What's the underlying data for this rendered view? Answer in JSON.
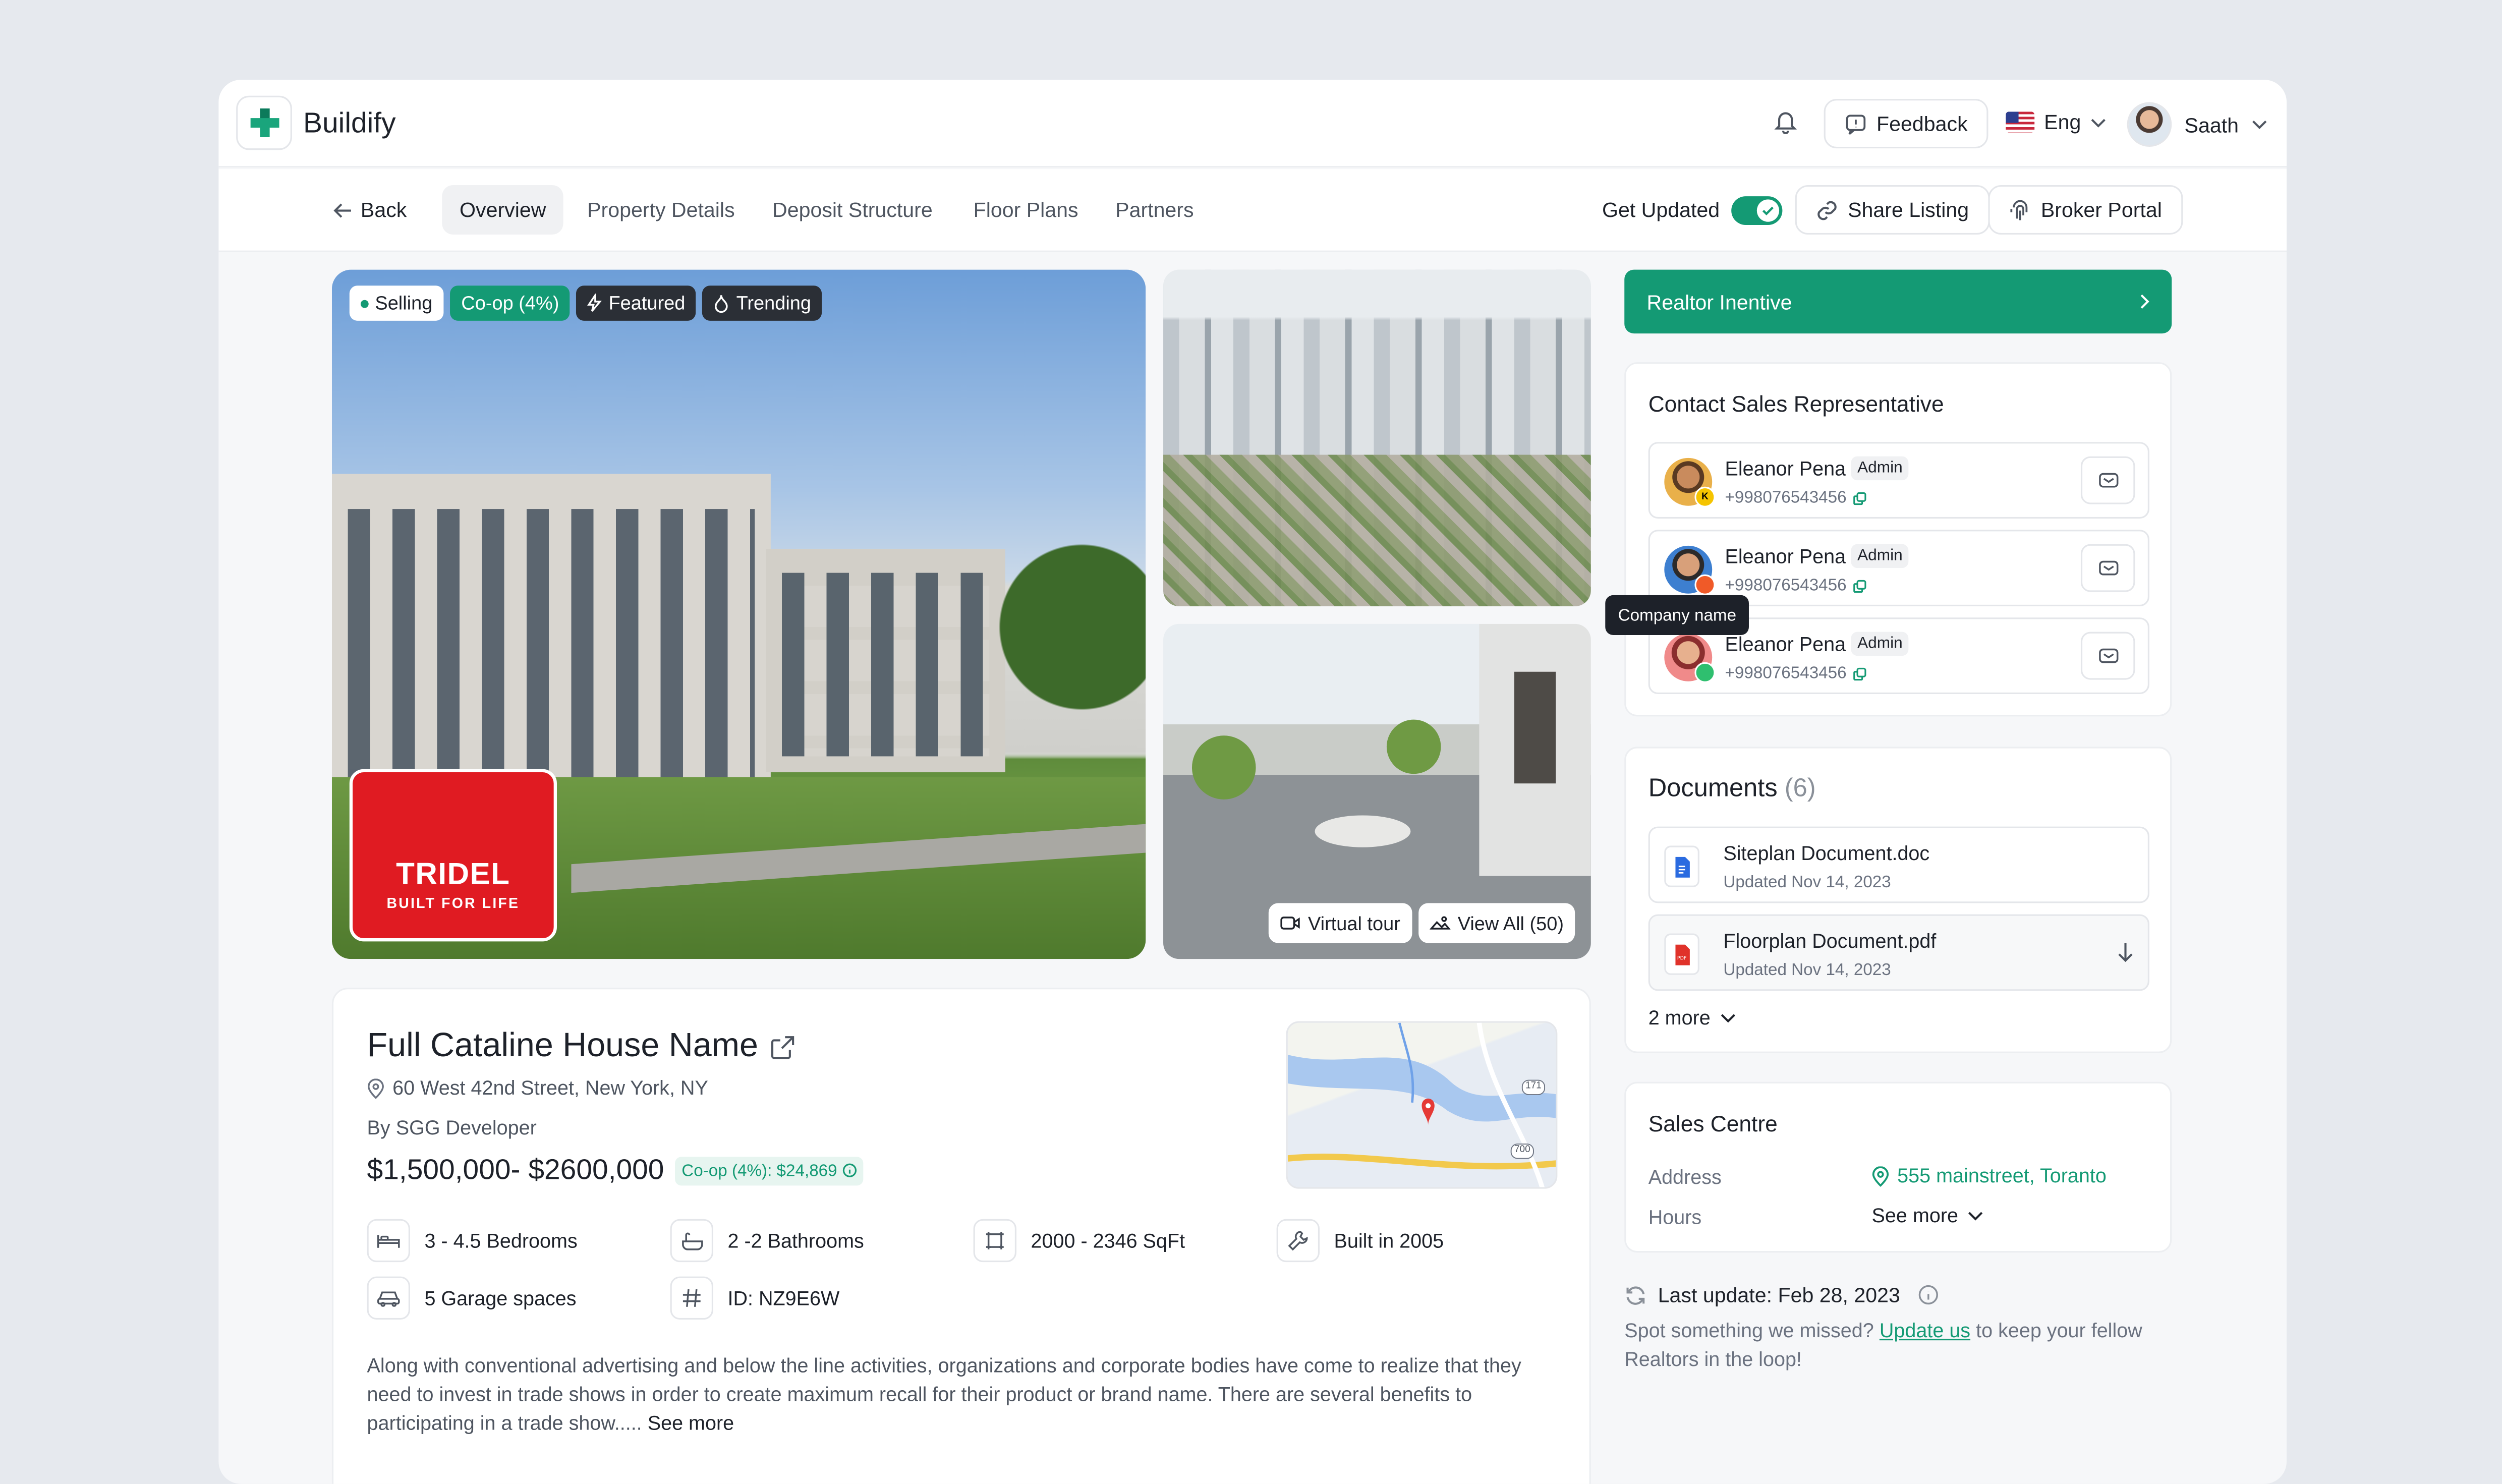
{
  "app": {
    "brand": "Buildify"
  },
  "topbar": {
    "feedback": "Feedback",
    "language": "Eng",
    "user": "Saath"
  },
  "nav": {
    "back": "Back",
    "tabs": [
      "Overview",
      "Property Details",
      "Deposit Structure",
      "Floor Plans",
      "Partners"
    ],
    "get_updated": "Get Updated",
    "share": "Share Listing",
    "broker": "Broker Portal"
  },
  "gallery": {
    "tags": {
      "selling": "Selling",
      "coop": "Co-op (4%)",
      "featured": "Featured",
      "trending": "Trending"
    },
    "logo_line1": "TRIDEL",
    "logo_line2": "BUILT FOR LIFE",
    "virtual_tour": "Virtual tour",
    "view_all": "View All (50)"
  },
  "incentive": {
    "label": "Realtor Inentive"
  },
  "contacts": {
    "title": "Contact Sales Representative",
    "reps": [
      {
        "name": "Eleanor Pena",
        "role": "Admin",
        "phone": "+998076543456"
      },
      {
        "name": "Eleanor Pena",
        "role": "Admin",
        "phone": "+998076543456"
      },
      {
        "name": "Eleanor Pena",
        "role": "Admin",
        "phone": "+998076543456"
      }
    ],
    "tooltip": "Company name"
  },
  "documents": {
    "title": "Documents",
    "count": "(6)",
    "files": [
      {
        "name": "Siteplan Document.doc",
        "updated": "Updated Nov 14, 2023"
      },
      {
        "name": "Floorplan Document.pdf",
        "updated": "Updated Nov 14, 2023"
      }
    ],
    "more": "2 more"
  },
  "sales_centre": {
    "title": "Sales Centre",
    "address_label": "Address",
    "address_value": "555 mainstreet, Toranto",
    "hours_label": "Hours",
    "hours_value": "See more"
  },
  "update": {
    "last": "Last update: Feb 28, 2023",
    "spot_before": "Spot something we missed?",
    "link": "Update us",
    "spot_after": "to keep your fellow Realtors in the loop!"
  },
  "property": {
    "name": "Full Cataline House Name",
    "address": "60 West 42nd Street, New York, NY",
    "developer": "By SGG Developer",
    "price": "$1,500,000- $2600,000",
    "coop": "Co-op (4%): $24,869",
    "map_labels": [
      "171",
      "700"
    ],
    "features": [
      "3 - 4.5 Bedrooms",
      "2 -2 Bathrooms",
      "2000 - 2346 SqFt",
      "Built in 2005",
      "5 Garage spaces",
      "ID: NZ9E6W"
    ],
    "description": "Along with conventional advertising and below the line activities, organizations and corporate bodies have come to realize that they need to invest in trade shows in order to create maximum recall for their product or brand name. There are several benefits to participating in a trade show.....",
    "see_more": "See more"
  },
  "colors": {
    "accent": "#149a74",
    "brand_red": "#e01b22"
  }
}
